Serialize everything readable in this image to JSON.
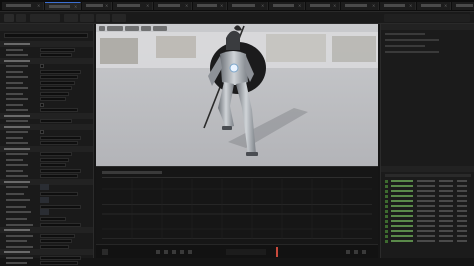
{
  "app": {
    "title": "",
    "accent": "#3c6fd1",
    "background": "#151515",
    "panel": "#1a1a1a",
    "list_accent": "#5a8a4a",
    "playhead": "#c84a3c"
  },
  "tabs": [
    {
      "label": "",
      "active": false
    },
    {
      "label": "",
      "active": true
    },
    {
      "label": "",
      "active": false
    },
    {
      "label": "",
      "active": false
    },
    {
      "label": "",
      "active": false
    },
    {
      "label": "",
      "active": false
    },
    {
      "label": "",
      "active": false
    },
    {
      "label": "",
      "active": false
    },
    {
      "label": "",
      "active": false
    },
    {
      "label": "",
      "active": false
    },
    {
      "label": "",
      "active": false
    },
    {
      "label": "",
      "active": false
    },
    {
      "label": "",
      "active": false
    }
  ],
  "toolbar": {
    "buttons": [
      {
        "label": "",
        "icon": "save-icon"
      },
      {
        "label": "",
        "icon": "browse-icon"
      },
      {
        "label": "",
        "icon": "skeleton-icon"
      },
      {
        "label": "",
        "icon": "mesh-icon"
      },
      {
        "label": "",
        "icon": "animation-icon"
      },
      {
        "label": "",
        "icon": "settings-icon"
      }
    ]
  },
  "details": {
    "search_placeholder": "",
    "sections": [
      {
        "title": ""
      },
      {
        "title": ""
      },
      {
        "title": ""
      },
      {
        "title": ""
      },
      {
        "title": ""
      },
      {
        "title": ""
      },
      {
        "title": ""
      },
      {
        "title": ""
      }
    ]
  },
  "viewport": {
    "toolbar_items": [
      "",
      "",
      "",
      "",
      ""
    ],
    "overlay_text": ""
  },
  "timeline": {
    "header_text": "",
    "footer_text": ""
  },
  "asset_panel": {
    "header": "",
    "rows": 13
  }
}
